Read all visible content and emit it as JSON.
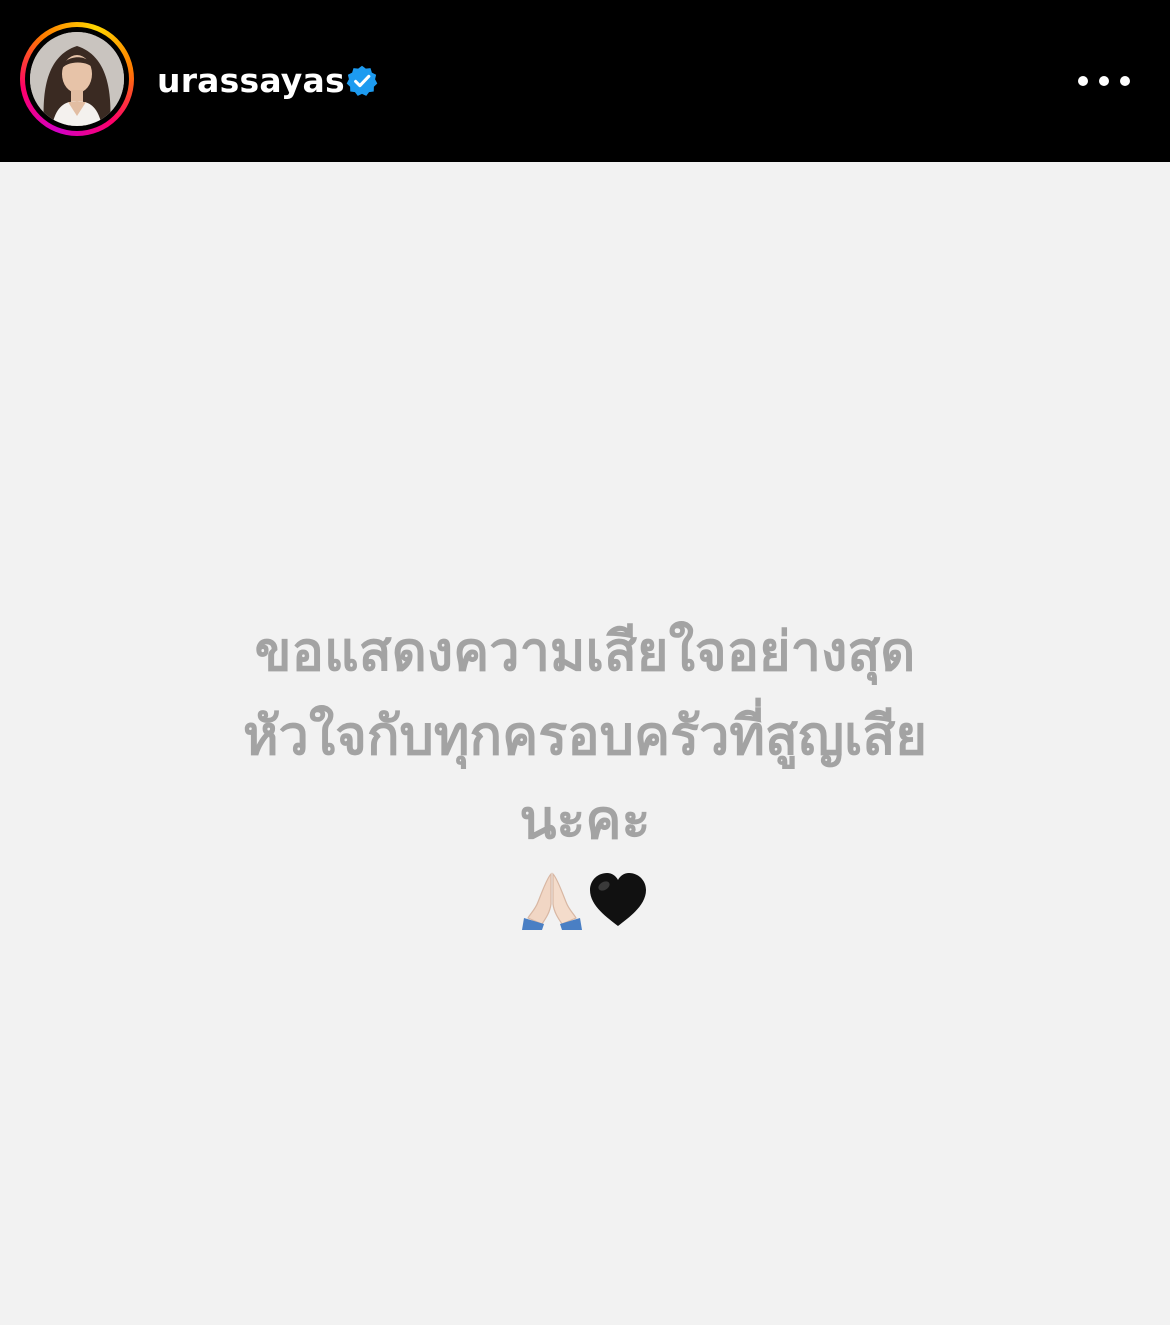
{
  "header": {
    "username": "urassayas",
    "verified": true,
    "avatar": "profile-photo",
    "menu_icon": "more-horizontal-icon",
    "colors": {
      "background": "#000000",
      "text": "#ffffff",
      "verified_badge": "#1d9bf0"
    }
  },
  "post": {
    "lines": [
      "ขอแสดงความเสียใจอย่างสุด",
      "หัวใจกับทุกครอบครัวที่สูญเสีย",
      "นะคะ"
    ],
    "emojis": [
      "folded-hands-emoji",
      "black-heart-emoji"
    ],
    "colors": {
      "background": "#f2f2f2",
      "text": "#a3a3a3"
    }
  }
}
